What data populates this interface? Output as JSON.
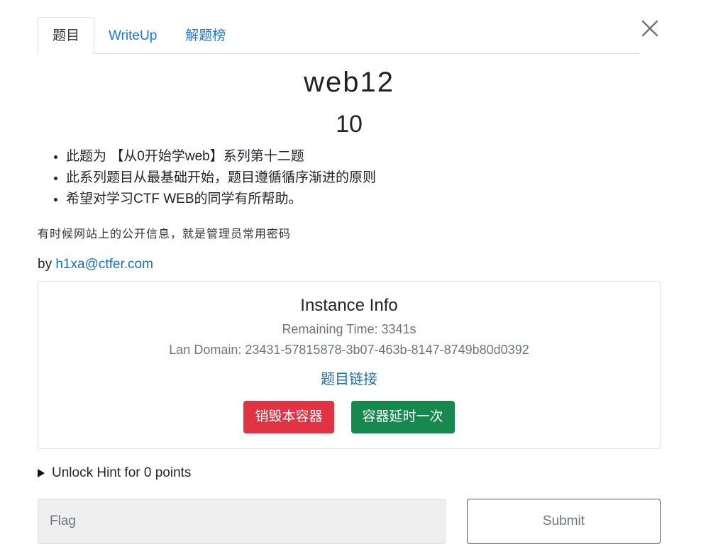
{
  "tabs": [
    {
      "label": "题目",
      "active": true
    },
    {
      "label": "WriteUp",
      "active": false
    },
    {
      "label": "解题榜",
      "active": false
    }
  ],
  "challenge": {
    "name": "web12",
    "points": "10",
    "description_items": [
      "此题为 【从0开始学web】系列第十二题",
      "此系列题目从最基础开始，题目遵循循序渐进的原则",
      "希望对学习CTF WEB的同学有所帮助。"
    ],
    "hint_text": "有时候网站上的公开信息，就是管理员常用密码",
    "author_prefix": "by",
    "author": "h1xa@ctfer.com"
  },
  "instance": {
    "title": "Instance Info",
    "remaining_time": "Remaining Time: 3341s",
    "lan_domain": "Lan Domain: 23431-57815878-3b07-463b-8147-8749b80d0392",
    "link_label": "题目链接",
    "destroy_label": "销毁本容器",
    "extend_label": "容器延时一次"
  },
  "hint": {
    "label": "Unlock Hint for 0 points"
  },
  "flag": {
    "placeholder": "Flag",
    "submit_label": "Submit"
  },
  "colors": {
    "danger": "#e03444",
    "success": "#168a4e",
    "link": "#1a6fc2"
  }
}
